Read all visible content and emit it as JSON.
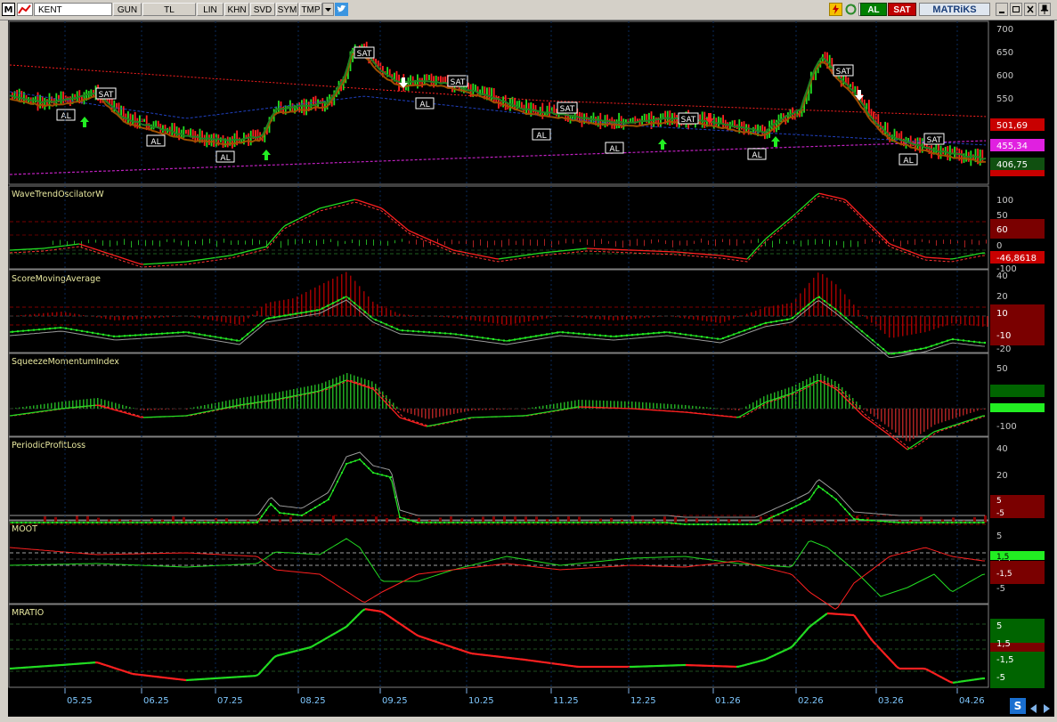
{
  "toolbar": {
    "symbol": "KENT",
    "periods": [
      "GUN",
      "TL",
      "LIN",
      "KHN",
      "SVD",
      "SYM",
      "TMP"
    ],
    "buy_label": "AL",
    "sell_label": "SAT",
    "brand": "MATRiKS",
    "app_letter": "M",
    "c_label": "C"
  },
  "panels": {
    "price": {
      "axis": [
        "700",
        "650",
        "600",
        "550"
      ],
      "tags": {
        "upper": "501,69",
        "mid": "455,34",
        "last": "406,75"
      },
      "signals": [
        "AL",
        "SAT"
      ],
      "colors": {
        "up": "#22dd22",
        "down": "#ff2020",
        "upper_band": "#ff2020",
        "lower_band": "#c020c0"
      }
    },
    "wt": {
      "title": "WaveTrendOscilatorW",
      "axis": [
        "100",
        "50",
        "0",
        "-100"
      ],
      "tags": [
        "60",
        "-46,8618"
      ]
    },
    "sma": {
      "title": "ScoreMovingAverage",
      "axis": [
        "40",
        "20",
        "-20"
      ],
      "tags": [
        "10",
        "-10"
      ]
    },
    "sqz": {
      "title": "SqueezeMomentumIndex",
      "axis": [
        "50",
        "0",
        "-100"
      ],
      "tags": [
        "0",
        ""
      ]
    },
    "ppl": {
      "title": "PeriodicProfitLoss",
      "axis": [
        "40",
        "20"
      ],
      "tags": [
        "5",
        "-5"
      ]
    },
    "moot": {
      "title": "MOOT",
      "axis": [
        "5",
        "1,5",
        "-5"
      ],
      "tags": [
        "1,5",
        "-1,5"
      ]
    },
    "mratio": {
      "title": "MRATIO",
      "axis": [
        "5",
        "1,5",
        "-1,5",
        "-5"
      ],
      "tags": [
        "5",
        "1,5",
        "-1,5",
        "-5"
      ]
    }
  },
  "dates": [
    "05.25",
    "06.25",
    "07.25",
    "08.25",
    "09.25",
    "10.25",
    "11.25",
    "12.25",
    "01.26",
    "02.26",
    "03.26",
    "04.26"
  ]
}
